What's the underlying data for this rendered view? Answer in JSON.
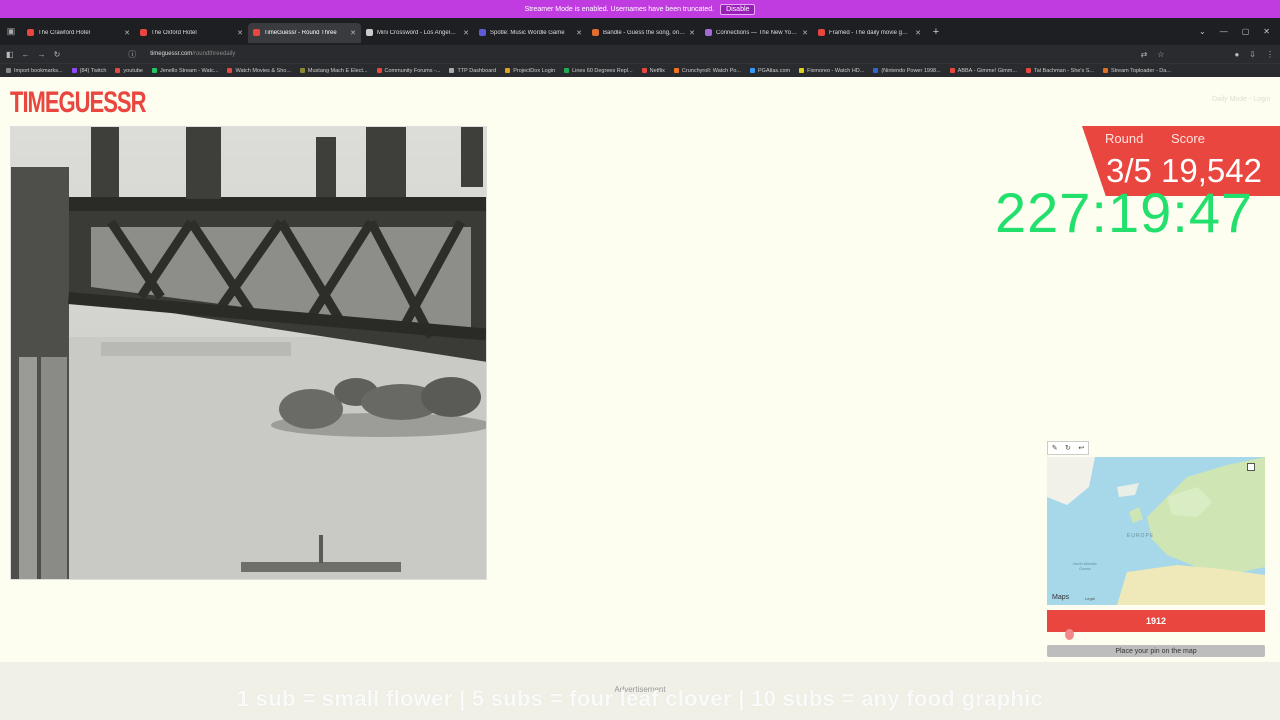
{
  "banner": {
    "text": "Streamer Mode is enabled. Usernames have been truncated.",
    "button": "Disable"
  },
  "tabs": [
    {
      "title": "The Crawford Hotel",
      "color": "#e9463f",
      "active": false
    },
    {
      "title": "The Oxford Hotel",
      "color": "#e9463f",
      "active": false
    },
    {
      "title": "TimeGuessr - Round Three",
      "color": "#e9463f",
      "active": true
    },
    {
      "title": "Mini Crossword - Los Angeles T",
      "color": "#cccccc",
      "active": false
    },
    {
      "title": "Spotle: Music Wordle Game",
      "color": "#5b5bd6",
      "active": false
    },
    {
      "title": "Bandle - Guess the song, one in",
      "color": "#e26d2e",
      "active": false
    },
    {
      "title": "Connections — The New York T",
      "color": "#a36bd6",
      "active": false
    },
    {
      "title": "Framed - The daily movie gues",
      "color": "#e9463f",
      "active": false
    }
  ],
  "address": {
    "host": "timeguessr.com",
    "path": "/roundthreedaily"
  },
  "bookmarks": [
    {
      "label": "Import bookmarks...",
      "color": "#888888"
    },
    {
      "label": "(84) Twitch",
      "color": "#9146ff"
    },
    {
      "label": "youtube",
      "color": "#e9463f"
    },
    {
      "label": "Jenello Stream - Watc...",
      "color": "#22c55e"
    },
    {
      "label": "Watch Movies & Sho...",
      "color": "#e9463f"
    },
    {
      "label": "Mustang Mach E Elect...",
      "color": "#888833"
    },
    {
      "label": "Community Forums -...",
      "color": "#e9463f"
    },
    {
      "label": "TTP Dashboard",
      "color": "#aaaaaa"
    },
    {
      "label": "ProjectDox Login",
      "color": "#e0a020"
    },
    {
      "label": "Lines 60 Degrees Repl...",
      "color": "#22aa55"
    },
    {
      "label": "Netflix",
      "color": "#e9463f"
    },
    {
      "label": "Crunchyroll: Watch Po...",
      "color": "#f47521"
    },
    {
      "label": "PGAtlas.com",
      "color": "#3399ff"
    },
    {
      "label": "Fixmoreo - Watch HD...",
      "color": "#e0d020"
    },
    {
      "label": "(Nintendo Power 1998...",
      "color": "#3366cc"
    },
    {
      "label": "ABBA - Gimme! Gimm...",
      "color": "#e9463f"
    },
    {
      "label": "Tal Bachman - She's S...",
      "color": "#e9463f"
    },
    {
      "label": "Stream Toploader - Da...",
      "color": "#e07020"
    }
  ],
  "header": {
    "logo": "TIMEGUESSR",
    "login": "Daily Mode - Login"
  },
  "hud": {
    "round_label": "Round",
    "score_label": "Score",
    "values": "3/5 19,542",
    "timer": "227:19:47"
  },
  "map": {
    "tools": [
      "✎",
      "↻",
      "↩"
    ],
    "label_europe": "EUROPE",
    "label_ocean": "North Atlantic Ocean",
    "brand": "Maps",
    "legal": "Legal",
    "year": "1912",
    "year_fraction": 0.1,
    "place_button": "Place your pin on the map"
  },
  "ad": {
    "label": "Advertisement",
    "overlay": "1 sub = small flower | 5 subs = four leaf clover | 10 subs = any food graphic"
  },
  "colors": {
    "accent": "#e9463f",
    "timer": "#22e06b",
    "background": "#fdfdf0"
  }
}
